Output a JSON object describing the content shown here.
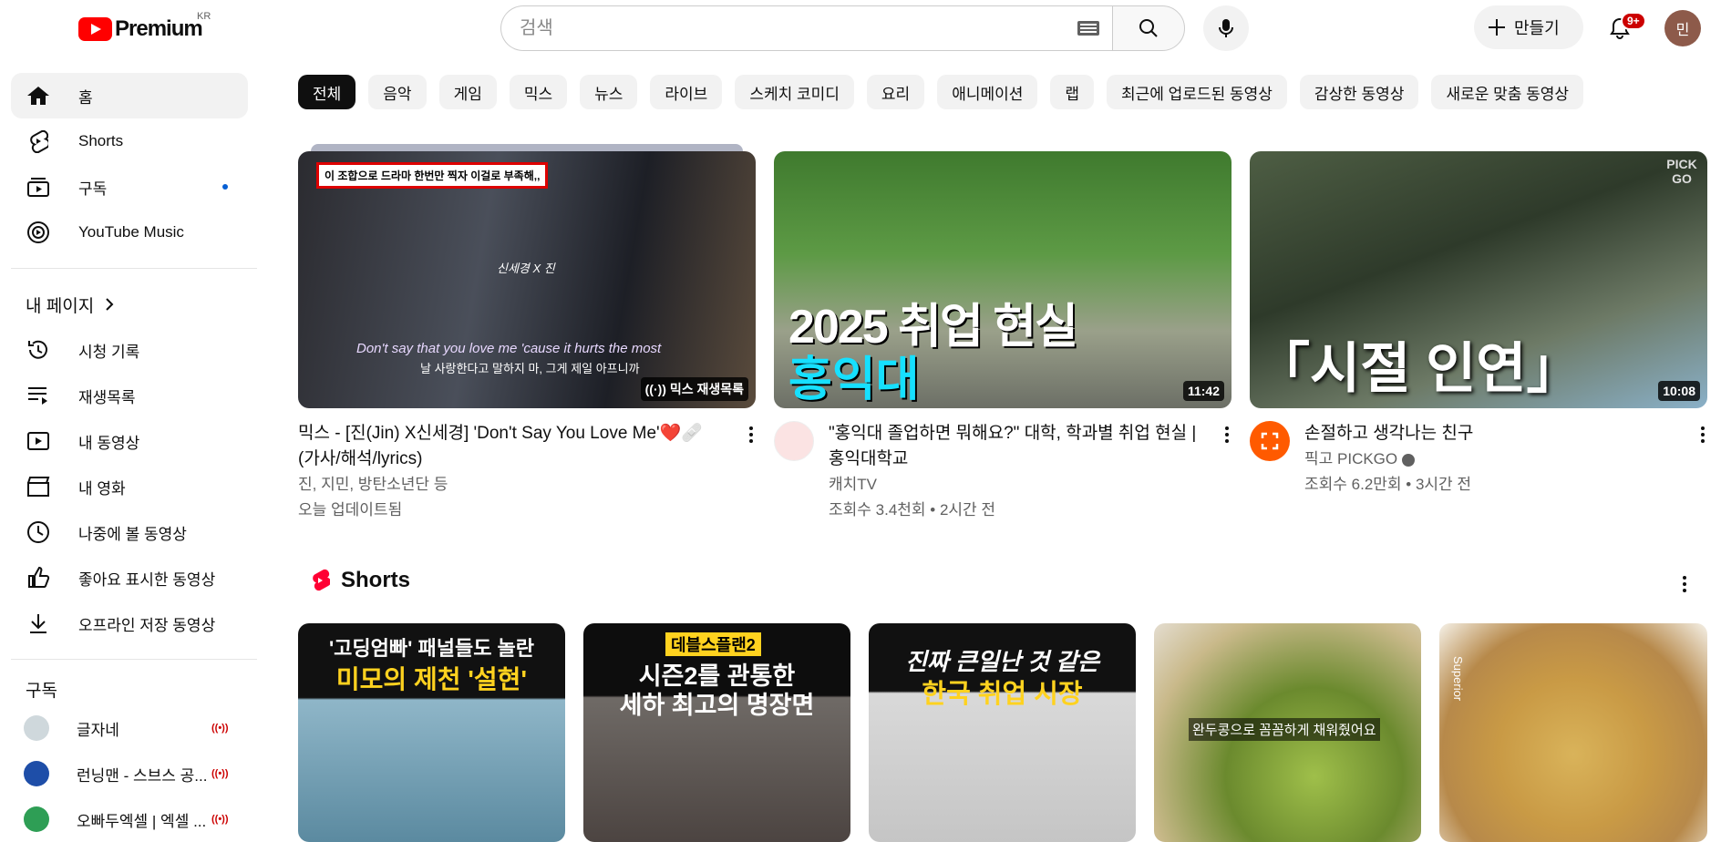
{
  "masthead": {
    "logo_text": "Premium",
    "region": "KR",
    "search_placeholder": "검색",
    "create_label": "만들기",
    "notification_badge": "9+",
    "avatar_letter": "민"
  },
  "sidebar": {
    "main": [
      {
        "label": "홈",
        "icon": "home-icon",
        "active": true
      },
      {
        "label": "Shorts",
        "icon": "shorts-icon"
      },
      {
        "label": "구독",
        "icon": "subscriptions-icon",
        "dot": true
      },
      {
        "label": "YouTube Music",
        "icon": "youtube-music-icon"
      }
    ],
    "mypage_title": "내 페이지",
    "mypage": [
      {
        "label": "시청 기록",
        "icon": "history-icon"
      },
      {
        "label": "재생목록",
        "icon": "playlists-icon"
      },
      {
        "label": "내 동영상",
        "icon": "my-videos-icon"
      },
      {
        "label": "내 영화",
        "icon": "movies-icon"
      },
      {
        "label": "나중에 볼 동영상",
        "icon": "watch-later-icon"
      },
      {
        "label": "좋아요 표시한 동영상",
        "icon": "liked-icon"
      },
      {
        "label": "오프라인 저장 동영상",
        "icon": "download-icon"
      }
    ],
    "subscriptions_title": "구독",
    "subscriptions": [
      {
        "label": "글자네",
        "color": "#cfd8dc"
      },
      {
        "label": "런닝맨 - 스브스 공...",
        "color": "#1e4ea8"
      },
      {
        "label": "오빠두엑셀 | 엑셀 ...",
        "color": "#2e9e55"
      }
    ]
  },
  "chips": [
    "전체",
    "음악",
    "게임",
    "믹스",
    "뉴스",
    "라이브",
    "스케치 코미디",
    "요리",
    "애니메이션",
    "랩",
    "최근에 업로드된 동영상",
    "감상한 동영상",
    "새로운 맞춤 동영상"
  ],
  "videos": [
    {
      "title": "믹스 - [진(Jin) X신세경] 'Don't Say You Love Me'❤️🩹 (가사/해석/lyrics)",
      "line1": "진, 지민, 방탄소년단 등",
      "line2": "오늘 업데이트됨",
      "duration": "((·)) 믹스 재생목록",
      "thumb_caption": "이 조합으로 드라마 한번만 찍자 이걸로 부족해,,",
      "thumb_sub1": "Don't say that you love me 'cause it hurts the most",
      "thumb_sub2": "날 사랑한다고 말하지 마, 그게 제일 아프니까",
      "thumb_name": "신세경 X 진"
    },
    {
      "title": "\"홍익대 졸업하면 뭐해요?\" 대학, 학과별 취업 현실 | 홍익대학교",
      "line1": "캐치TV",
      "line2": "조회수 3.4천회 • 2시간 전",
      "duration": "11:42",
      "thumb_big": "2025 취업 현실",
      "thumb_big2": "홍익대"
    },
    {
      "title": "손절하고 생각나는 친구",
      "line1": "픽고 PICKGO",
      "line2": "조회수 6.2만회 • 3시간 전",
      "duration": "10:08",
      "thumb_big": "「시절 인연」",
      "thumb_logo": "PICK GO"
    }
  ],
  "shorts_title": "Shorts",
  "shorts": [
    {
      "line1": "'고딩엄빠' 패널들도 놀란",
      "line2": "미모의 제천 '설현'"
    },
    {
      "line0": "데블스플랜2",
      "line1": "시즌2를 관통한",
      "line2": "세하 최고의 명장면"
    },
    {
      "line1": "진짜 큰일난 것 같은",
      "line2": "한국 취업 시장"
    },
    {
      "line1": "완두콩으로 꼼꼼하게 채워줬어요"
    },
    {
      "line1": "Superior"
    }
  ]
}
